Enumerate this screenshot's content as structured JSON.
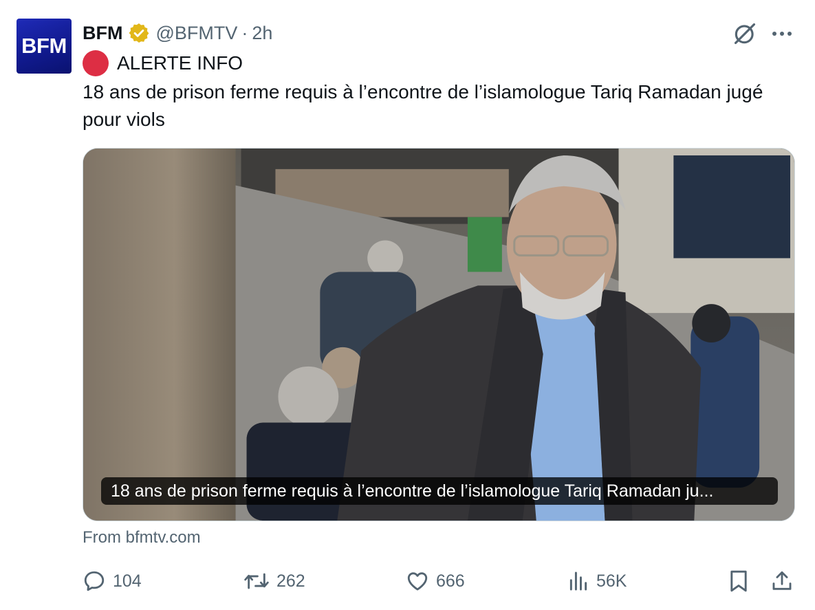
{
  "author": {
    "avatar_text": "BFM",
    "display_name": "BFM",
    "verified": "gold-check-badge",
    "handle": "@BFMTV",
    "separator": "·",
    "time": "2h"
  },
  "tweet": {
    "alert_label": "ALERTE INFO",
    "text": "18 ans de prison ferme requis à l’encontre de l’islamologue Tariq Ramadan jugé pour viols"
  },
  "card": {
    "caption": "18 ans de prison ferme requis à l’encontre de l’islamologue Tariq Ramadan ju...",
    "source": "From bfmtv.com"
  },
  "actions": {
    "replies": "104",
    "reposts": "262",
    "likes": "666",
    "views": "56K"
  },
  "icons": [
    "grok-icon",
    "more-icon",
    "reply-icon",
    "repost-icon",
    "like-icon",
    "views-icon",
    "bookmark-icon",
    "share-icon"
  ],
  "colors": {
    "text": "#0f1419",
    "secondary": "#536471",
    "alert_dot": "#dd2e44",
    "verified_badge": "#e2b719",
    "avatar_bg": "#1a24a8",
    "border": "#cfd9de"
  }
}
